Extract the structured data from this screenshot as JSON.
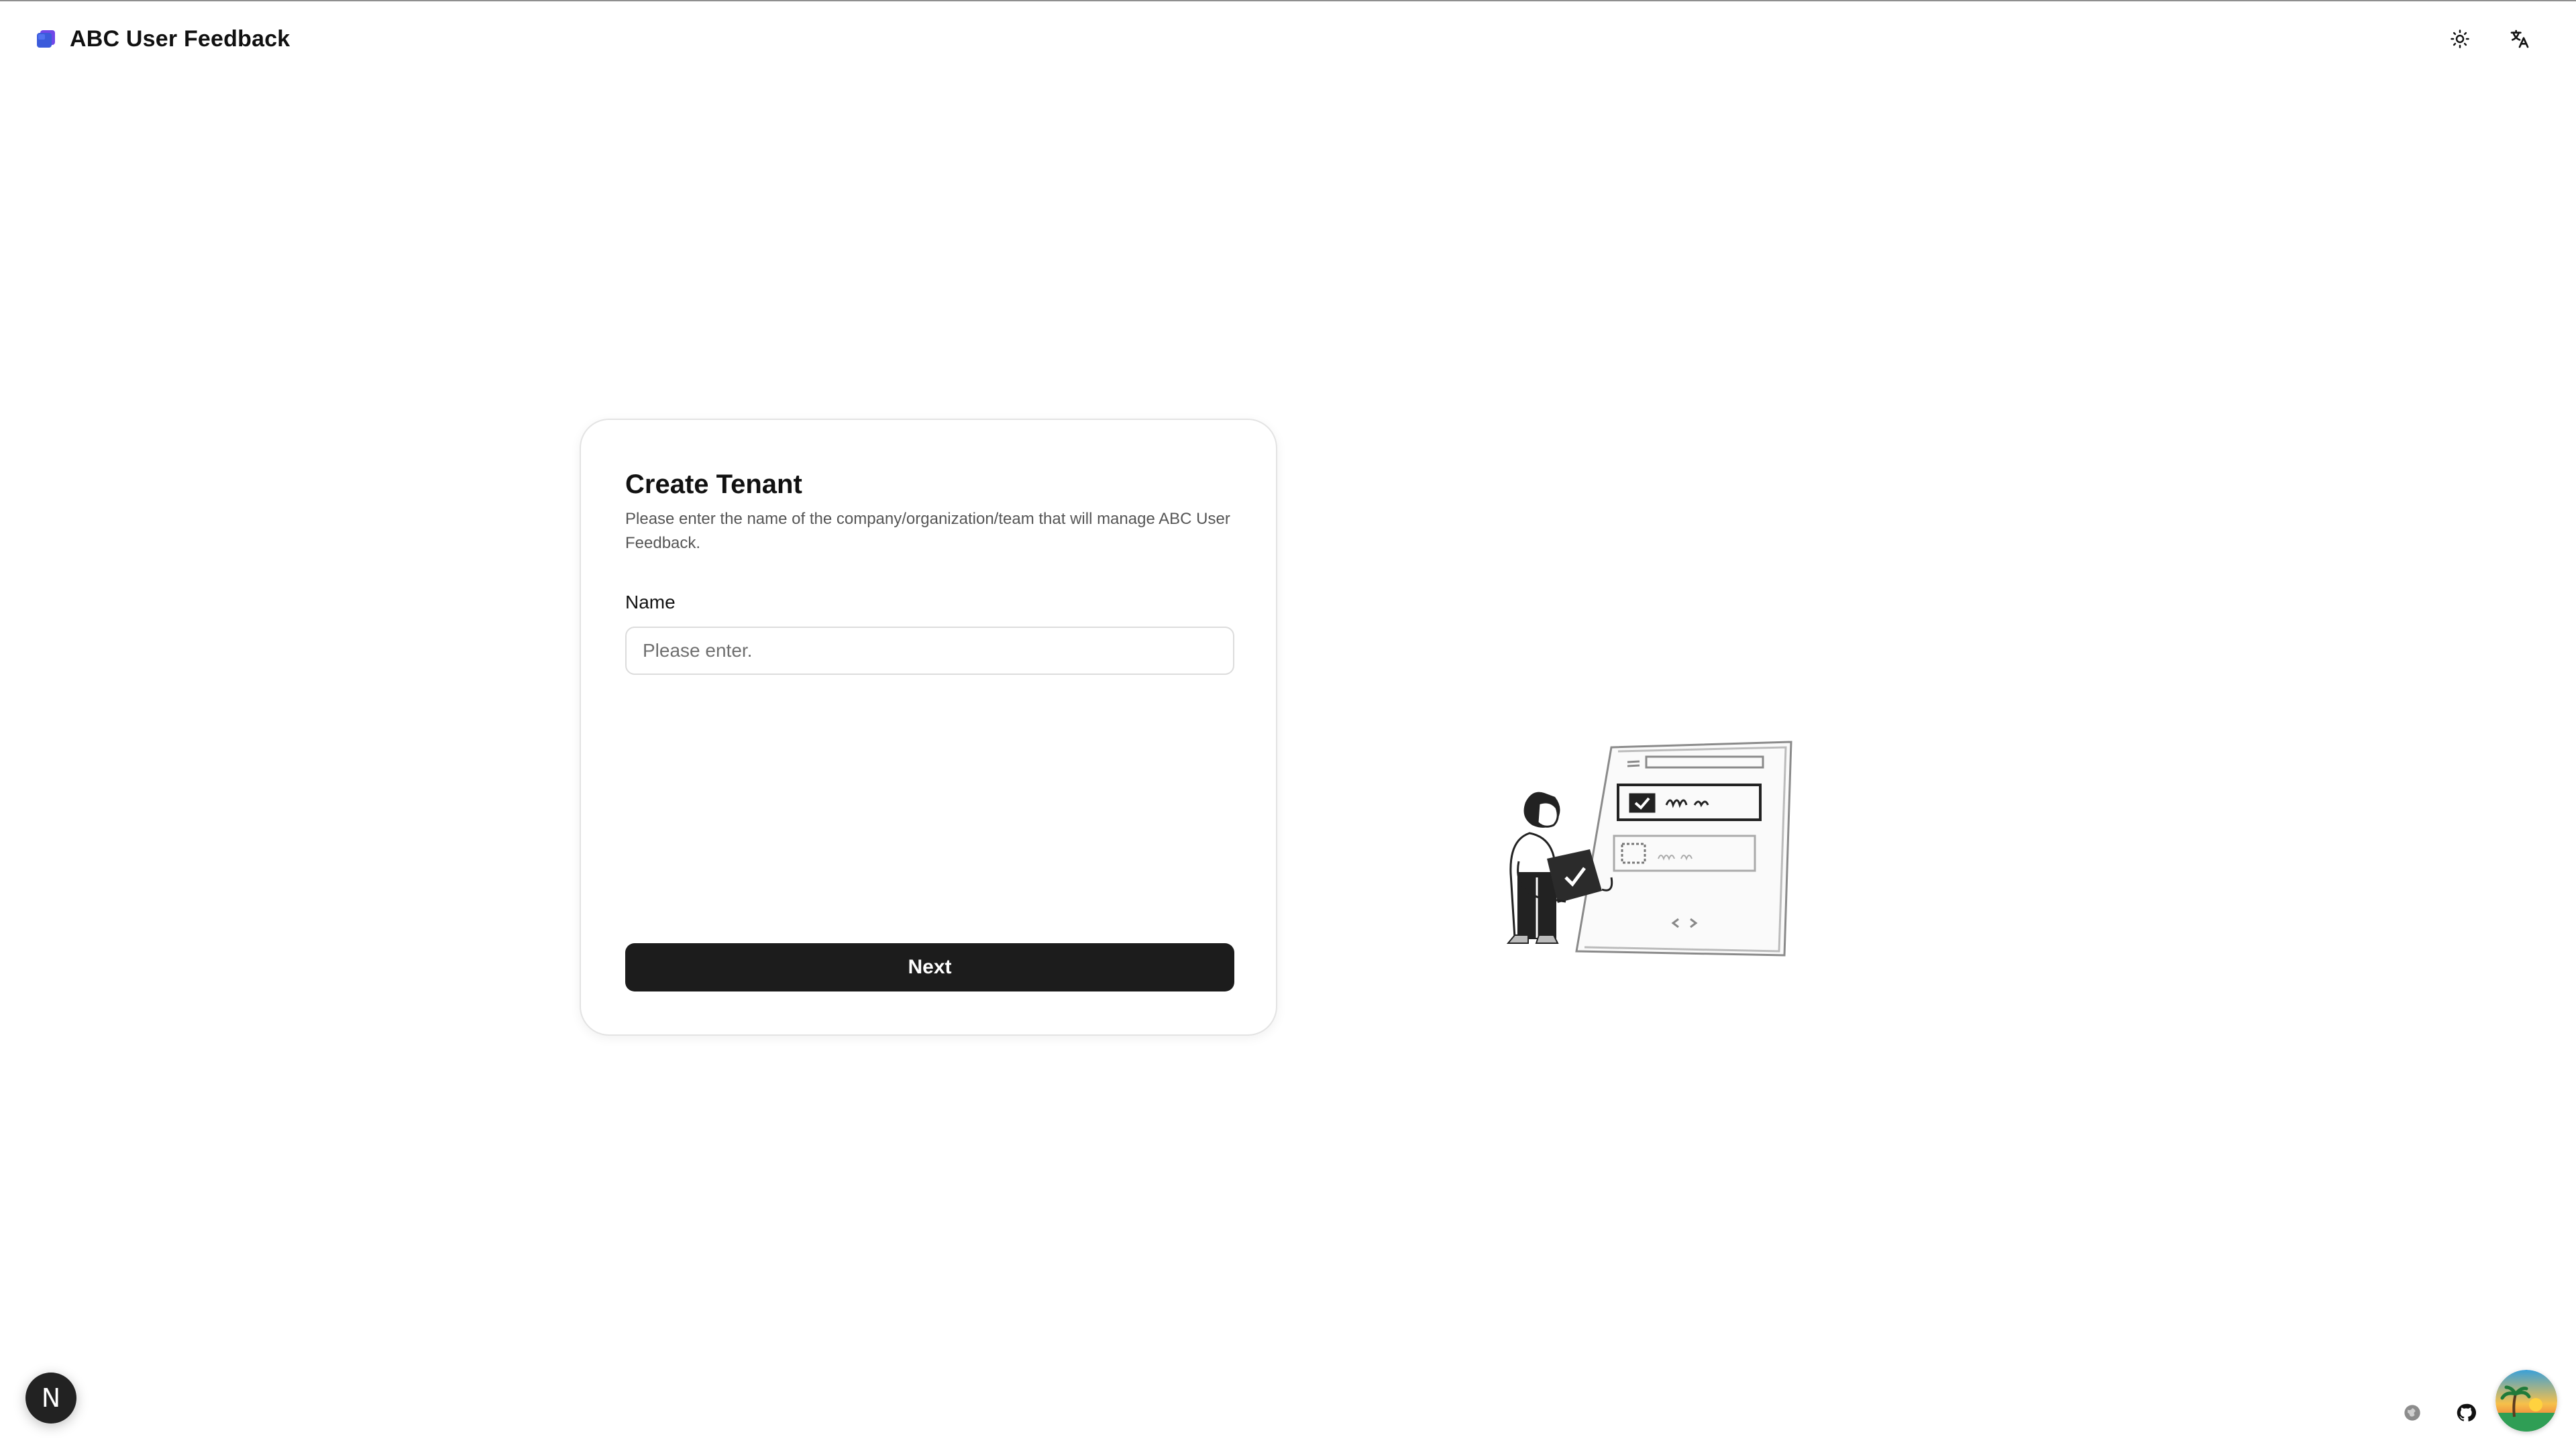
{
  "app": {
    "title": "ABC User Feedback"
  },
  "header": {
    "theme_icon": "sun-icon",
    "language_icon": "translate-icon"
  },
  "card": {
    "title": "Create Tenant",
    "description": "Please enter the name of the company/organization/team that will manage ABC User Feedback.",
    "name_label": "Name",
    "name_input": {
      "value": "",
      "placeholder": "Please enter."
    },
    "next_label": "Next"
  },
  "floating": {
    "nextjs_badge_letter": "N"
  },
  "dock": {
    "globe_icon": "globe-icon",
    "github_icon": "github-icon",
    "avatar": "avatar-image"
  },
  "colors": {
    "primary_button": "#1c1c1c",
    "card_border": "#e3e3e3",
    "text": "#111111",
    "muted_text": "#555555",
    "logo_blue": "#3b5bdb",
    "logo_purple": "#7048e8"
  }
}
